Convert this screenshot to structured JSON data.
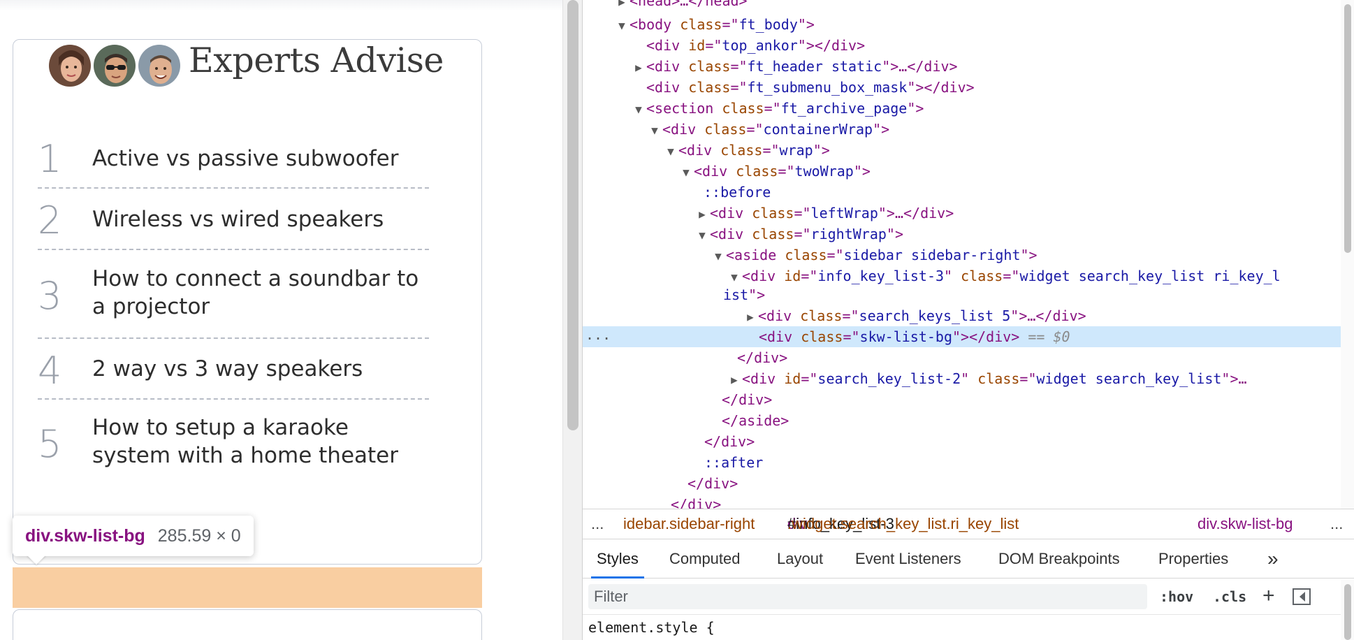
{
  "widget": {
    "title": "Experts Advise",
    "items": [
      {
        "num": "1",
        "text": "Active vs passive subwoofer"
      },
      {
        "num": "2",
        "text": "Wireless vs wired speakers"
      },
      {
        "num": "3",
        "text": "How to connect a soundbar to a projector"
      },
      {
        "num": "4",
        "text": "2 way vs 3 way speakers"
      },
      {
        "num": "5",
        "text": "How to setup a karaoke system with a home theater"
      }
    ]
  },
  "tooltip": {
    "tag": "div.skw-list-bg",
    "dims": "285.59 × 0"
  },
  "highlight_color": "#f9cb9c",
  "dom": {
    "head_tag": "<head>",
    "head_ellipsis": "…",
    "head_close": "</head>",
    "lines": {
      "l1_tag": "body",
      "l1_attr": "class",
      "l1_val": "ft_body",
      "l2_tag": "div",
      "l2_attr": "id",
      "l2_val": "top_ankor",
      "l2_close": "</div>",
      "l3_tag": "div",
      "l3_attr": "class",
      "l3_val": "ft_header static",
      "l3_close": "</div>",
      "l4_tag": "div",
      "l4_attr": "class",
      "l4_val": "ft_submenu_box_mask",
      "l4_close": "</div>",
      "l5_tag": "section",
      "l5_attr": "class",
      "l5_val": "ft_archive_page",
      "l6_tag": "div",
      "l6_attr": "class",
      "l6_val": "containerWrap",
      "l7_tag": "div",
      "l7_attr": "class",
      "l7_val": "wrap",
      "l8_tag": "div",
      "l8_attr": "class",
      "l8_val": "twoWrap",
      "l9_pseudo": "::before",
      "l10_tag": "div",
      "l10_attr": "class",
      "l10_val": "leftWrap",
      "l10_close": "</div>",
      "l11_tag": "div",
      "l11_attr": "class",
      "l11_val": "rightWrap",
      "l12_tag": "aside",
      "l12_attr": "class",
      "l12_val": "sidebar sidebar-right",
      "l13_tag": "div",
      "l13_attr": "id",
      "l13_val": "info_key_list-3",
      "l13_attr2": "class",
      "l13_val2a": "widget search_key_list ri_key_l",
      "l13_val2b": "ist",
      "l14_tag": "div",
      "l14_attr": "class",
      "l14_val": "search_keys_list 5",
      "l14_close": "</div>",
      "l15_tag": "div",
      "l15_attr": "class",
      "l15_val": "skw-list-bg",
      "l15_close": "</div>",
      "l15_eq": "== $0",
      "l16_close": "</div>",
      "l17_tag": "div",
      "l17_attr": "id",
      "l17_val": "search_key_list-2",
      "l17_attr2": "class",
      "l17_val2": "widget search_key_list",
      "l18_close": "</div>",
      "l19_close": "</aside>",
      "l20_close": "</div>",
      "l21_pseudo": "::after",
      "l22_close": "</div>",
      "l23_close": "</div>"
    },
    "ellipsis": "…",
    "gutter_dots": "..."
  },
  "breadcrumb": {
    "lead": "...",
    "c1": "idebar.sidebar-right",
    "c2_tag": "div",
    "c2_id": "#info_key_list-3",
    "c2_cls": ".widget.search_key_list.ri_key_list",
    "c3": "div.skw-list-bg",
    "tail": "..."
  },
  "styles_tabs": [
    "Styles",
    "Computed",
    "Layout",
    "Event Listeners",
    "DOM Breakpoints",
    "Properties",
    "»"
  ],
  "filter": {
    "placeholder": "Filter",
    "hov": ":hov",
    "cls": ".cls",
    "add": "+"
  },
  "element_style": "element.style {"
}
